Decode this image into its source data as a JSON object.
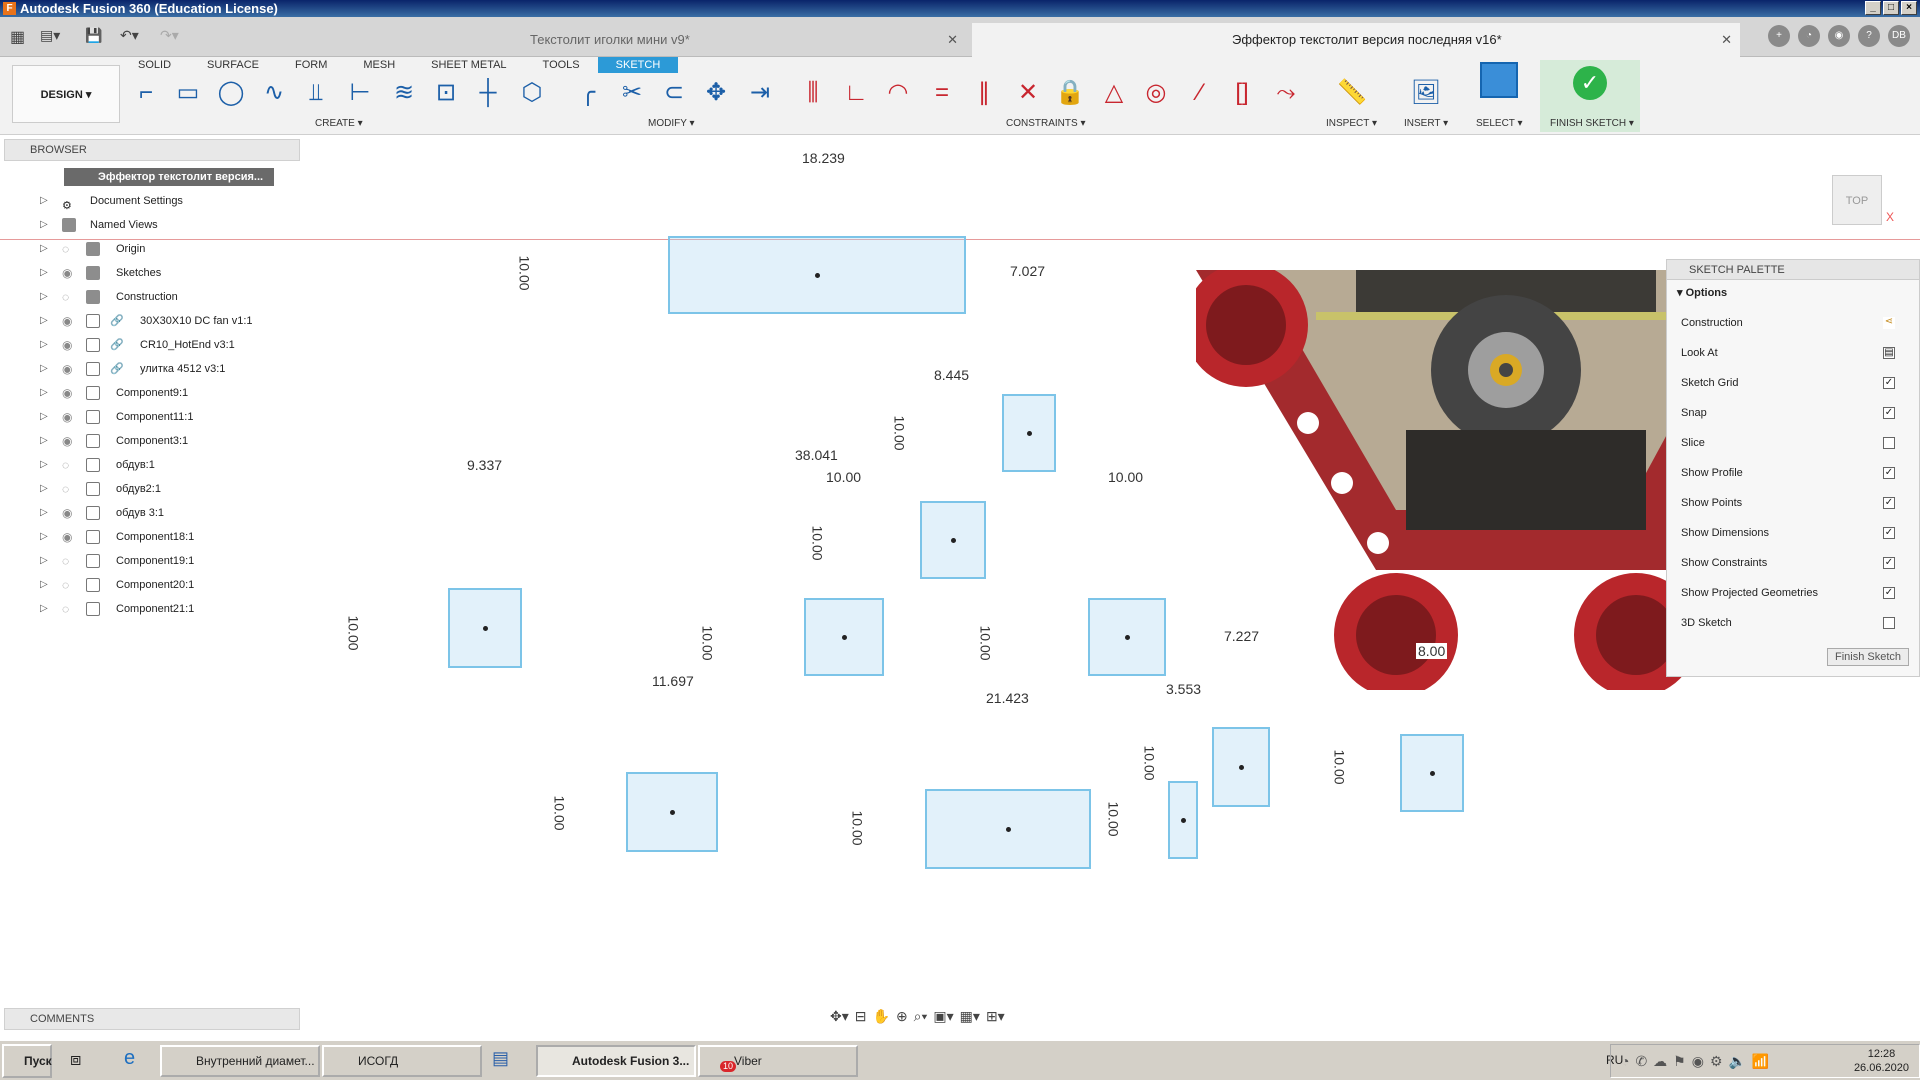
{
  "window": {
    "title": "Autodesk Fusion 360 (Education License)"
  },
  "doc_tabs": [
    {
      "label": "Текстолит иголки мини v9*"
    },
    {
      "label": "Эффектор текстолит версия последняя v16*"
    }
  ],
  "user_initials": "DB",
  "mode_tabs": [
    "SOLID",
    "SURFACE",
    "FORM",
    "MESH",
    "SHEET METAL",
    "TOOLS",
    "SKETCH"
  ],
  "design_button": "DESIGN ▾",
  "groups": {
    "create": "CREATE ▾",
    "modify": "MODIFY ▾",
    "constraints": "CONSTRAINTS ▾",
    "inspect": "INSPECT ▾",
    "insert": "INSERT ▾",
    "select": "SELECT ▾",
    "finish": "FINISH SKETCH ▾"
  },
  "browser": {
    "header": "BROWSER",
    "root": "Эффектор текстолит версия...",
    "items": [
      "Document Settings",
      "Named Views",
      "Origin",
      "Sketches",
      "Construction",
      "30X30X10 DC fan  v1:1",
      "CR10_HotEnd v3:1",
      "улитка 4512 v3:1",
      "Component9:1",
      "Component11:1",
      "Component3:1",
      "обдув:1",
      "обдув2:1",
      "обдув 3:1",
      "Component18:1",
      "Component19:1",
      "Component20:1",
      "Component21:1"
    ]
  },
  "comments": {
    "header": "COMMENTS"
  },
  "dimensions": [
    "18.239",
    "10.00",
    "7.027",
    "8.445",
    "10.00",
    "38.041",
    "10.00",
    "10.00",
    "9.337",
    "10.00",
    "10.00",
    "10.00",
    "10.00",
    "11.697",
    "21.423",
    "3.553",
    "7.227",
    "8.00",
    "10.00",
    "10.00",
    "10.00",
    "10.00",
    "10.00"
  ],
  "palette": {
    "title": "SKETCH PALETTE",
    "section": "Options",
    "rows": [
      {
        "label": "Construction",
        "checked": ""
      },
      {
        "label": "Look At",
        "checked": ""
      },
      {
        "label": "Sketch Grid",
        "checked": "✓"
      },
      {
        "label": "Snap",
        "checked": "✓"
      },
      {
        "label": "Slice",
        "checked": ""
      },
      {
        "label": "Show Profile",
        "checked": "✓"
      },
      {
        "label": "Show Points",
        "checked": "✓"
      },
      {
        "label": "Show Dimensions",
        "checked": "✓"
      },
      {
        "label": "Show Constraints",
        "checked": "✓"
      },
      {
        "label": "Show Projected Geometries",
        "checked": "✓"
      },
      {
        "label": "3D Sketch",
        "checked": ""
      }
    ],
    "finish_button": "Finish Sketch"
  },
  "viewcube": {
    "label": "TOP",
    "axis": "X"
  },
  "taskbar": {
    "start": "Пуск",
    "items": [
      "Внутренний диамет...",
      "ИСОГД",
      "Autodesk Fusion 3...",
      "Viber"
    ],
    "viber_badge": "10",
    "lang": "RU",
    "time": "12:28",
    "date": "26.06.2020"
  },
  "colors": {
    "accent": "#2c9ad7",
    "sketch_line": "#7cc4e8",
    "finish": "#2db34a",
    "model_red": "#b8262b"
  }
}
